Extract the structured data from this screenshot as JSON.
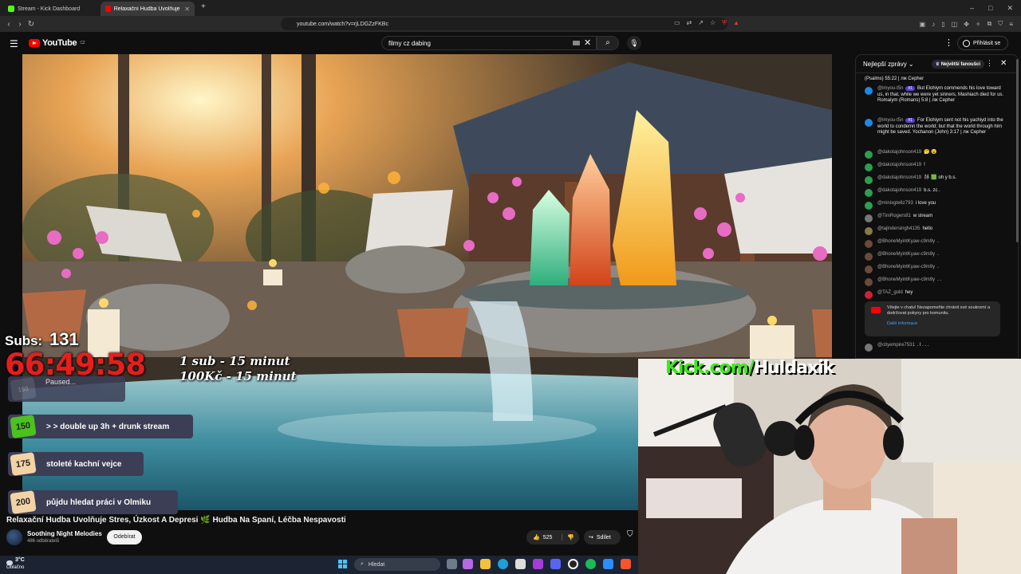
{
  "browser": {
    "tabs": [
      {
        "label": "Stream - Kick Dashboard",
        "favicon": "#53fc18"
      },
      {
        "label": "Relaxační Hudba Uvolňuje Stres",
        "favicon": "#ff0000"
      }
    ],
    "new_tab": "+",
    "url": "youtube.com/watch?v=rjLDGZzFKBc",
    "window_controls": [
      "–",
      "□",
      "✕"
    ]
  },
  "youtube": {
    "logo_text": "YouTube",
    "region": "CZ",
    "search_value": "filmy cz dabing",
    "signin_label": "Přihlásit se"
  },
  "overlay": {
    "subs_label": "Subs:",
    "subs_value": "131",
    "timer": "66:49:58",
    "rule1": "1 sub - 15 minut",
    "rule2": "100Kč - 15 minut",
    "paused": "Paused...",
    "goals": [
      {
        "badge": "150",
        "text": "> > double up 3h + drunk stream"
      },
      {
        "badge": "175",
        "text": "stoleté kachní vejce"
      },
      {
        "badge": "200",
        "text": "půjdu hledat práci v Olmiku"
      }
    ],
    "kick_prefix": "Kick.com/",
    "kick_name": "Huldaxik"
  },
  "video": {
    "title": "Relaxační Hudba Uvolňuje Stres, Úzkost A Depresi 🌿 Hudba Na Spaní, Léčba Nespavosti",
    "channel": "Soothing Night Melodies",
    "subscribers": "486 odběratelů",
    "subscribe_label": "Odebírat",
    "likes": "525",
    "share_label": "Sdílet"
  },
  "chat": {
    "mode_label": "Nejlepší zprávy",
    "top_fans_label": "Největší fanoušci",
    "messages": [
      {
        "user": "",
        "badge": "",
        "text": "(Psalms) 55:22 | лж Cepher",
        "color": "#0f0f0f"
      },
      {
        "user": "@imyou-t5n",
        "badge": "#1",
        "text": "But Elohiym commends his love toward us, in that, while we were yet sinners, Mashiach died for us. Romaiym (Romans) 5:8 | лж Cepher",
        "color": "#1e88e5"
      },
      {
        "user": "@imyou-t5n",
        "badge": "#1",
        "text": "For Elohiym sent not his yachiyd into the world to condemn the world; but that the world through him might be saved. Yochanon (John) 3:17 | лж Cepher",
        "color": "#1e88e5"
      },
      {
        "user": "@dakotajohnson419",
        "badge": "",
        "text": "🤔 😮",
        "color": "#2e9e4f"
      },
      {
        "user": "@dakotajohnson419",
        "badge": "",
        "text": "!",
        "color": "#2e9e4f"
      },
      {
        "user": "@dakotajohnson419",
        "badge": "",
        "text": "👫 🟩 oh y b.s.",
        "color": "#2e9e4f"
      },
      {
        "user": "@dakotajohnson419",
        "badge": "",
        "text": "b.s. zc .",
        "color": "#2e9e4f"
      },
      {
        "user": "@minixgte6z793",
        "badge": "",
        "text": "i love you",
        "color": "#2e9e4f"
      },
      {
        "user": "@TimRogers81",
        "badge": "",
        "text": "w stream",
        "color": "#777"
      },
      {
        "user": "@tajindersingh4135",
        "badge": "",
        "text": "hello",
        "color": "#8a7a4a"
      },
      {
        "user": "@BhoneMyintKyaw-c9m9y",
        "badge": "",
        "text": ".",
        "color": "#6b4a3a"
      },
      {
        "user": "@BhoneMyintKyaw-c9m9y",
        "badge": "",
        "text": ".",
        "color": "#6b4a3a"
      },
      {
        "user": "@BhoneMyintKyaw-c9m9y",
        "badge": "",
        "text": ".",
        "color": "#6b4a3a"
      },
      {
        "user": "@BhoneMyintKyaw-c9m9y",
        "badge": "",
        "text": ". .",
        "color": "#6b4a3a"
      },
      {
        "user": "@TAZ_gold",
        "badge": "",
        "text": "hey",
        "color": "#c23"
      }
    ],
    "notice_text": "Vítejte v chatu! Nezapomeňte chránit své soukromí a dodržovat pokyny pro komunitu.",
    "notice_link": "Další informace",
    "after_notice": [
      {
        "user": "@cityempire7531",
        "text": ". l . . .",
        "color": "#777"
      }
    ]
  },
  "taskbar": {
    "temp": "3°C",
    "condition": "Oblačno",
    "search_label": "Hledat"
  }
}
